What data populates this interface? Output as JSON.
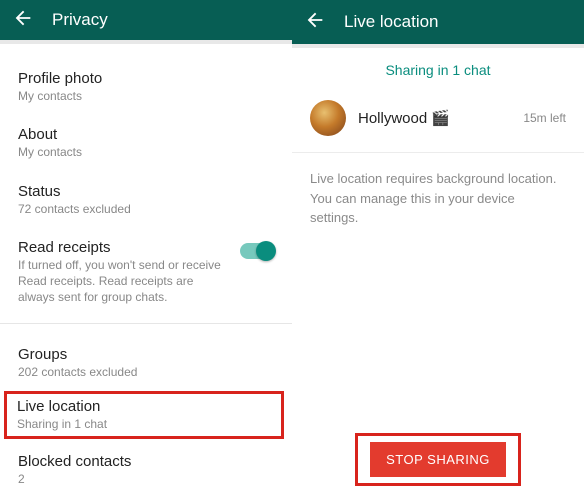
{
  "left": {
    "title": "Privacy",
    "profile_photo": {
      "title": "Profile photo",
      "sub": "My contacts"
    },
    "about": {
      "title": "About",
      "sub": "My contacts"
    },
    "status": {
      "title": "Status",
      "sub": "72 contacts excluded"
    },
    "read_receipts": {
      "title": "Read receipts",
      "sub": "If turned off, you won't send or receive Read receipts. Read receipts are always sent for group chats."
    },
    "groups": {
      "title": "Groups",
      "sub": "202 contacts excluded"
    },
    "live_location": {
      "title": "Live location",
      "sub": "Sharing in 1 chat"
    },
    "blocked": {
      "title": "Blocked contacts",
      "sub": "2"
    }
  },
  "right": {
    "title": "Live location",
    "sharing_header": "Sharing in 1 chat",
    "chat": {
      "name": "Hollywood 🎬",
      "time": "15m left"
    },
    "info": "Live location requires background location. You can manage this in your device settings.",
    "stop_label": "STOP SHARING"
  }
}
